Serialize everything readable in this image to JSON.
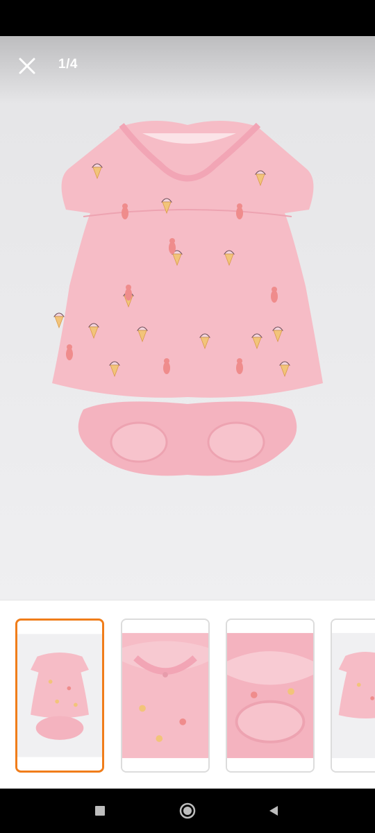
{
  "viewer": {
    "counter": "1/4",
    "close_icon": "close-icon",
    "background_color": "#eeeef0",
    "product_color": "#f6bcc6"
  },
  "thumbnails": [
    {
      "name": "thumbnail-1",
      "selected": true,
      "view": "full-garment"
    },
    {
      "name": "thumbnail-2",
      "selected": false,
      "view": "collar-closeup"
    },
    {
      "name": "thumbnail-3",
      "selected": false,
      "view": "bloomer-closeup"
    },
    {
      "name": "thumbnail-4",
      "selected": false,
      "view": "full-garment-partial"
    }
  ],
  "colors": {
    "selected_border": "#f07d1a"
  },
  "navigation": {
    "recents_icon": "square-recents-icon",
    "home_icon": "circle-home-icon",
    "back_icon": "triangle-back-icon"
  }
}
